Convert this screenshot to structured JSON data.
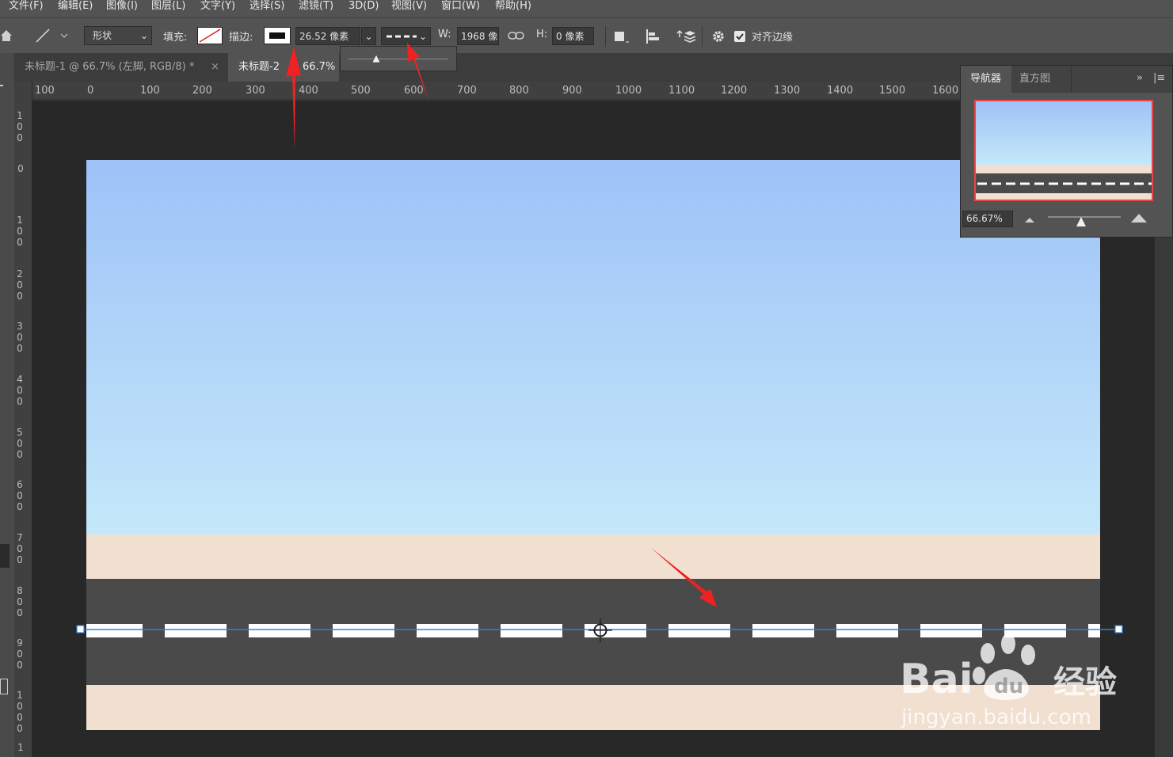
{
  "menu": [
    "文件(F)",
    "编辑(E)",
    "图像(I)",
    "图层(L)",
    "文字(Y)",
    "选择(S)",
    "滤镜(T)",
    "3D(D)",
    "视图(V)",
    "窗口(W)",
    "帮助(H)"
  ],
  "options": {
    "mode": "形状",
    "fill_label": "填充:",
    "stroke_label": "描边:",
    "stroke_width": "26.52 像素",
    "w_label": "W:",
    "w_value": "1968 像",
    "h_label": "H:",
    "h_value": "0 像素",
    "align_edges": "对齐边缘",
    "align_edges_checked": true
  },
  "tabs": [
    {
      "label": "未标题-1 @ 66.7% (左脚, RGB/8) *",
      "close": "×",
      "active": false
    },
    {
      "label": "未标题-2",
      "active": true
    },
    {
      "label": "66.7%"
    }
  ],
  "ruler_h": [
    "100",
    "0",
    "100",
    "200",
    "300",
    "400",
    "500",
    "600",
    "700",
    "800",
    "900",
    "1000",
    "1100",
    "1200",
    "1300",
    "1400",
    "1500",
    "1600"
  ],
  "ruler_v": [
    "100",
    "0",
    "100",
    "200",
    "300",
    "400",
    "500",
    "600",
    "700",
    "800",
    "900",
    "1000",
    "1"
  ],
  "navigator": {
    "tab_active": "导航器",
    "tab_other": "直方图",
    "zoom": "66.67%"
  },
  "canvas_colors": {
    "sky_top": "#9ec2f8",
    "sky_bottom": "#c4e8f9",
    "sand": "#f1dfd0",
    "road": "#4a4a4a",
    "dash": "#ffffff",
    "path": "#2f80e0"
  },
  "watermark": {
    "brand": "Bai du 经验",
    "url": "jingyan.baidu.com"
  }
}
